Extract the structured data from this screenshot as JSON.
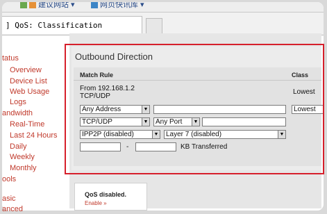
{
  "browser": {
    "bookmarks": [
      "建议网站 ▾",
      "网页快讯库 ▾"
    ],
    "tab_title": "] QoS: Classification"
  },
  "sidebar": {
    "items": [
      {
        "label": "tatus",
        "type": "section"
      },
      {
        "label": "Overview",
        "type": "sub"
      },
      {
        "label": "Device List",
        "type": "sub"
      },
      {
        "label": "Web Usage",
        "type": "sub"
      },
      {
        "label": "Logs",
        "type": "sub"
      },
      {
        "label": "andwidth",
        "type": "section"
      },
      {
        "label": "Real-Time",
        "type": "sub"
      },
      {
        "label": "Last 24 Hours",
        "type": "sub"
      },
      {
        "label": "Daily",
        "type": "sub"
      },
      {
        "label": "Weekly",
        "type": "sub"
      },
      {
        "label": "Monthly",
        "type": "sub"
      },
      {
        "label": "ools",
        "type": "section"
      },
      {
        "label": "asic",
        "type": "section"
      },
      {
        "label": "anced",
        "type": "section"
      }
    ]
  },
  "main": {
    "panel_title": "Outbound Direction",
    "columns": {
      "match_rule": "Match Rule",
      "class": "Class"
    },
    "rule": {
      "from_line": "From 192.168.1.2",
      "proto_line": "TCP/UDP",
      "class": "Lowest"
    },
    "form": {
      "address_select": "Any Address",
      "address_text": "",
      "class_select": "Lowest",
      "protocol_select": "TCP/UDP",
      "port_select": "Any Port",
      "port_text": "",
      "ipp2p_select": "IPP2P (disabled)",
      "layer7_select": "Layer 7 (disabled)",
      "kb_from": "",
      "kb_dash": "-",
      "kb_to": "",
      "kb_label": "KB Transferred"
    }
  },
  "qos": {
    "status": "QoS disabled.",
    "link": "Enable »"
  },
  "colors": {
    "highlight": "#d61f2b",
    "link": "#c0392b"
  }
}
